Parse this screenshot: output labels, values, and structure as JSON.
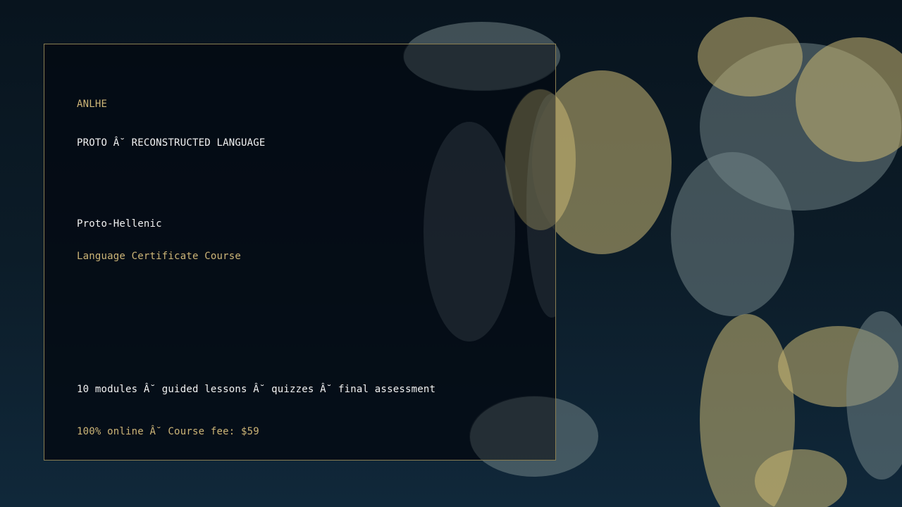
{
  "brand": "ANLHE",
  "kicker": "PROTO Â˘ RECONSTRUCTED LANGUAGE",
  "title": "Proto-Hellenic",
  "subtitle": "Language Certificate Course",
  "details": "10 modules Â˘ guided lessons Â˘ quizzes Â˘ final assessment",
  "fee_line": "100% online Â˘ Course fee: $59",
  "colors": {
    "accent_gold": "#cdb577",
    "text_light": "#f2f2f2",
    "panel_border": "#8a7e52",
    "background": "#0c1c28"
  }
}
